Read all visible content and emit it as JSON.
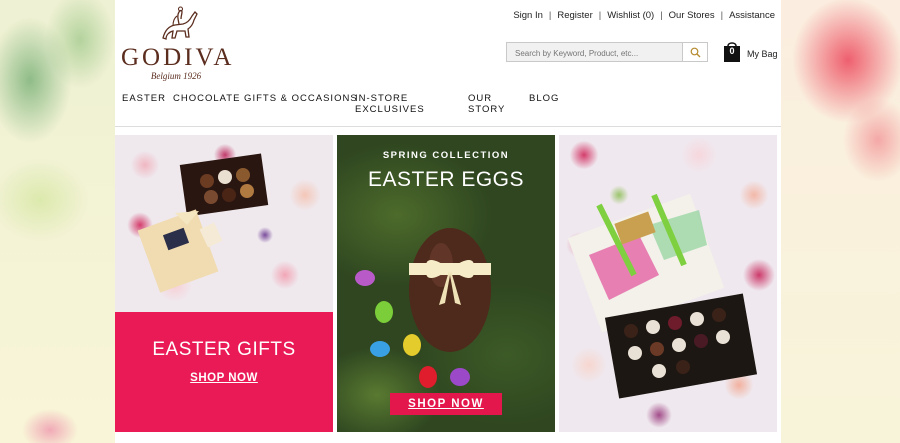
{
  "brand": {
    "name": "GODIVA",
    "tagline": "Belgium 1926",
    "color": "#5b2d1e"
  },
  "utility_nav": [
    "Sign In",
    "Register",
    "Wishlist (0)",
    "Our Stores",
    "Assistance"
  ],
  "search": {
    "placeholder": "Search by Keyword, Product, etc...",
    "icon": "search-icon"
  },
  "bag": {
    "count": "0",
    "label": "My Bag",
    "icon": "shopping-bag-icon"
  },
  "main_nav": [
    {
      "label": "EASTER"
    },
    {
      "label": "CHOCOLATE GIFTS & OCCASIONS"
    },
    {
      "label": "IN-STORE EXCLUSIVES"
    },
    {
      "label": "OUR STORY"
    },
    {
      "label": "BLOG"
    }
  ],
  "promos": [
    {
      "title": "EASTER GIFTS",
      "cta": "SHOP NOW",
      "color": "#ea1a56"
    },
    {
      "kicker": "SPRING COLLECTION",
      "title": "EASTER EGGS",
      "cta": "SHOP NOW",
      "color": "#e3174c"
    },
    {}
  ],
  "colors": {
    "accent_pink": "#ea1a56",
    "page_bg": "#ffffff"
  }
}
